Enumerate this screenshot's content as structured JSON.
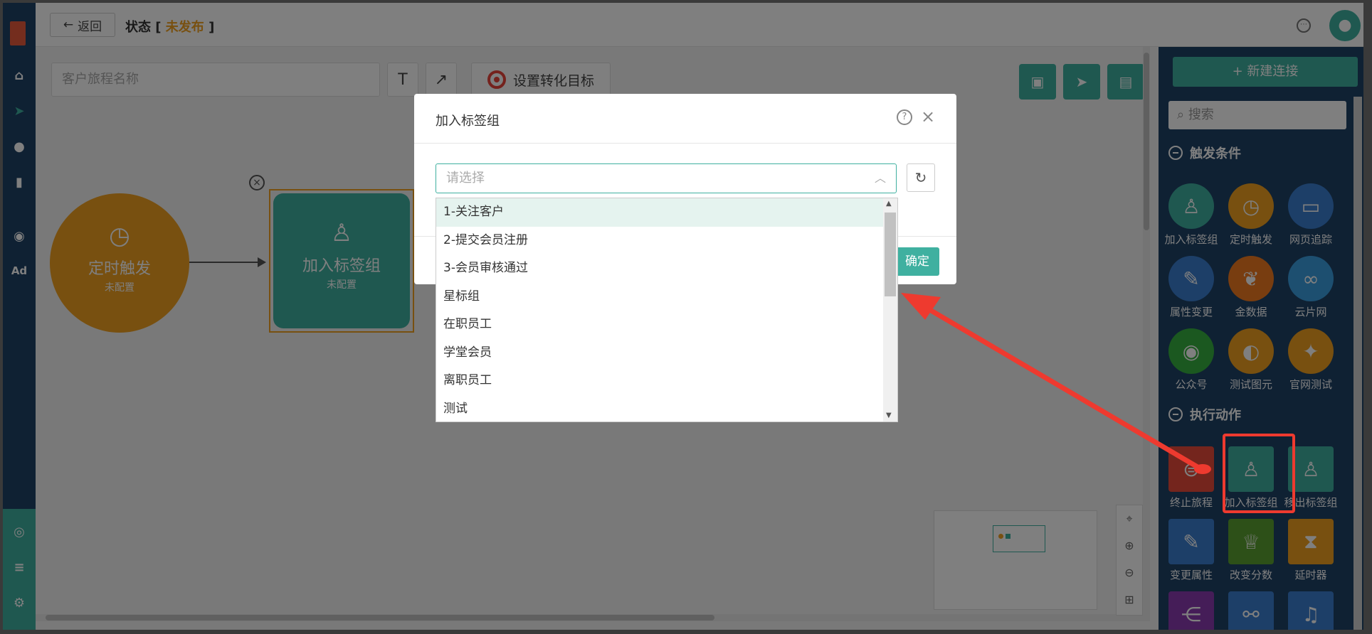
{
  "topbar": {
    "back_label": "返回",
    "status_label": "状态",
    "status_value": "未发布"
  },
  "canvas": {
    "name_placeholder": "客户旅程名称",
    "text_tool": "T",
    "arrow_tool": "↗",
    "goal_label": "设置转化目标",
    "nodes": [
      {
        "title": "定时触发",
        "sub": "未配置"
      },
      {
        "title": "加入标签组",
        "sub": "未配置"
      }
    ]
  },
  "modal": {
    "title": "加入标签组",
    "select_placeholder": "请选择",
    "ok_label": "确定",
    "options": [
      "1-关注客户",
      "2-提交会员注册",
      "3-会员审核通过",
      "星标组",
      "在职员工",
      "学堂会员",
      "离职员工",
      "测试"
    ]
  },
  "right_panel": {
    "new_connection": "+ 新建连接",
    "search_placeholder": "搜索",
    "sections": [
      {
        "title": "触发条件",
        "items": [
          {
            "label": "加入标签组",
            "icon": "user-plus-icon",
            "color": "#3fb0a0"
          },
          {
            "label": "定时触发",
            "icon": "clock-icon",
            "color": "#f0a020"
          },
          {
            "label": "网页追踪",
            "icon": "webpage-icon",
            "color": "#3b7ed0"
          },
          {
            "label": "属性变更",
            "icon": "edit-icon",
            "color": "#3b7ed0"
          },
          {
            "label": "金数据",
            "icon": "plant-icon",
            "color": "#f07a20"
          },
          {
            "label": "云片网",
            "icon": "cloud-link-icon",
            "color": "#3b9ee0"
          },
          {
            "label": "公众号",
            "icon": "wechat-icon",
            "color": "#36b040"
          },
          {
            "label": "测试图元",
            "icon": "badge-icon",
            "color": "#f0a020"
          },
          {
            "label": "官网测试",
            "icon": "wrench-icon",
            "color": "#f0a020"
          }
        ]
      },
      {
        "title": "执行动作",
        "items": [
          {
            "label": "终止旅程",
            "icon": "stop-icon",
            "color": "#e84a3a"
          },
          {
            "label": "加入标签组",
            "icon": "user-plus-icon",
            "color": "#3fb0a0"
          },
          {
            "label": "移出标签组",
            "icon": "user-minus-icon",
            "color": "#3fb0a0"
          },
          {
            "label": "变更属性",
            "icon": "edit-icon",
            "color": "#3b7ed0"
          },
          {
            "label": "改变分数",
            "icon": "trophy-icon",
            "color": "#5aa030"
          },
          {
            "label": "延时器",
            "icon": "hourglass-icon",
            "color": "#f0a020"
          },
          {
            "label": "",
            "icon": "branch-icon",
            "color": "#8a3ab0"
          },
          {
            "label": "",
            "icon": "webhook-icon",
            "color": "#3b7ed0"
          },
          {
            "label": "",
            "icon": "bell-icon",
            "color": "#3b7ed0"
          }
        ]
      }
    ]
  }
}
